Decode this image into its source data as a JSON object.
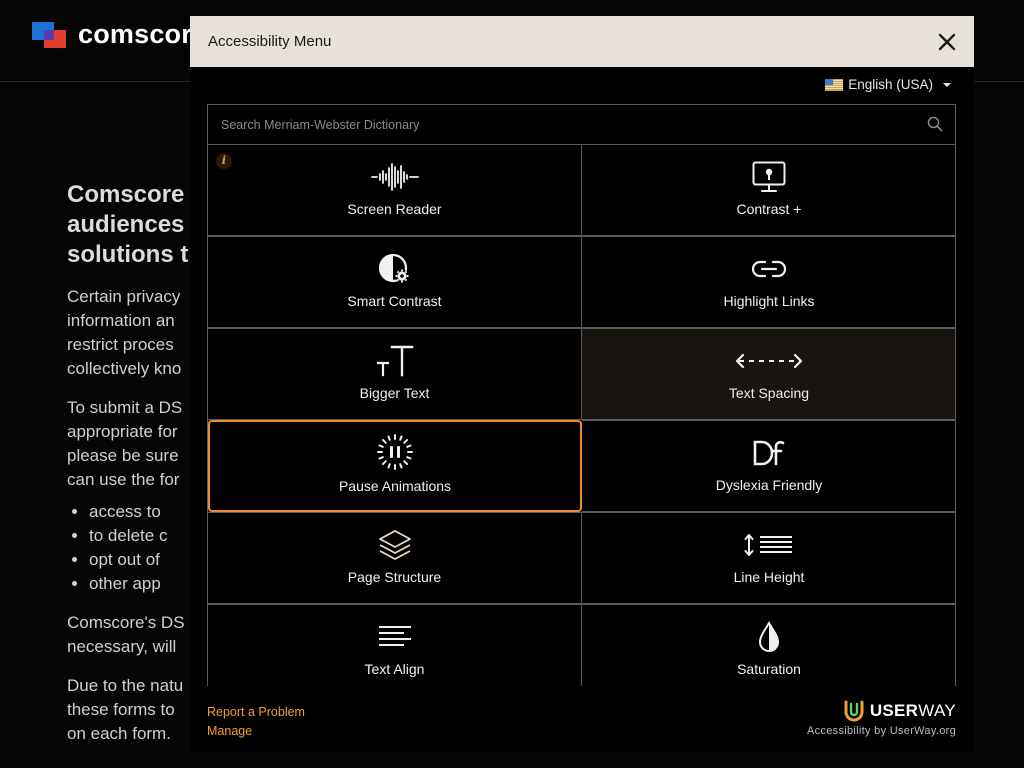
{
  "background_page": {
    "brand": "comscore",
    "heading_lines": [
      "Comscore",
      "audiences",
      "solutions t"
    ],
    "paragraphs": [
      [
        "Certain privacy",
        "information an",
        "restrict proces",
        "collectively kno"
      ],
      [
        "To submit a DS",
        "appropriate for",
        "please be sure",
        "can use the for"
      ]
    ],
    "list_items": [
      "access to",
      "to delete c",
      "opt out of",
      "other app"
    ],
    "paragraph_after_list": [
      "Comscore's DS",
      "necessary, will"
    ],
    "paragraph_last": [
      "Due to the natu",
      "these forms to",
      "on each form."
    ]
  },
  "modal": {
    "title": "Accessibility Menu",
    "close_icon": "close-icon",
    "language": "English (USA)",
    "search": {
      "placeholder": "Search Merriam-Webster Dictionary"
    },
    "tiles": [
      {
        "label": "Screen Reader",
        "icon": "waveform-icon"
      },
      {
        "label": "Contrast +",
        "icon": "monitor-icon"
      },
      {
        "label": "Smart Contrast",
        "icon": "half-circle-gear-icon"
      },
      {
        "label": "Highlight Links",
        "icon": "link-icon"
      },
      {
        "label": "Bigger Text",
        "icon": "text-size-icon"
      },
      {
        "label": "Text Spacing",
        "icon": "text-spacing-icon"
      },
      {
        "label": "Pause Animations",
        "icon": "pause-icon"
      },
      {
        "label": "Dyslexia Friendly",
        "icon": "dyslexia-df-icon"
      },
      {
        "label": "Page Structure",
        "icon": "layers-icon"
      },
      {
        "label": "Line Height",
        "icon": "line-height-icon"
      },
      {
        "label": "Text Align",
        "icon": "text-align-icon"
      },
      {
        "label": "Saturation",
        "icon": "droplet-icon"
      }
    ],
    "info_badge": "i",
    "footer": {
      "report_link": "Report a Problem",
      "manage_link": "Manage"
    },
    "brand": {
      "word_bold": "USER",
      "word_thin": "WAY",
      "credit": "Accessibility by UserWay.org"
    }
  },
  "colors": {
    "accent": "#f08c2a",
    "link": "#f0a030",
    "header_bg": "#e8e1d9",
    "panel_bg": "#000000"
  }
}
